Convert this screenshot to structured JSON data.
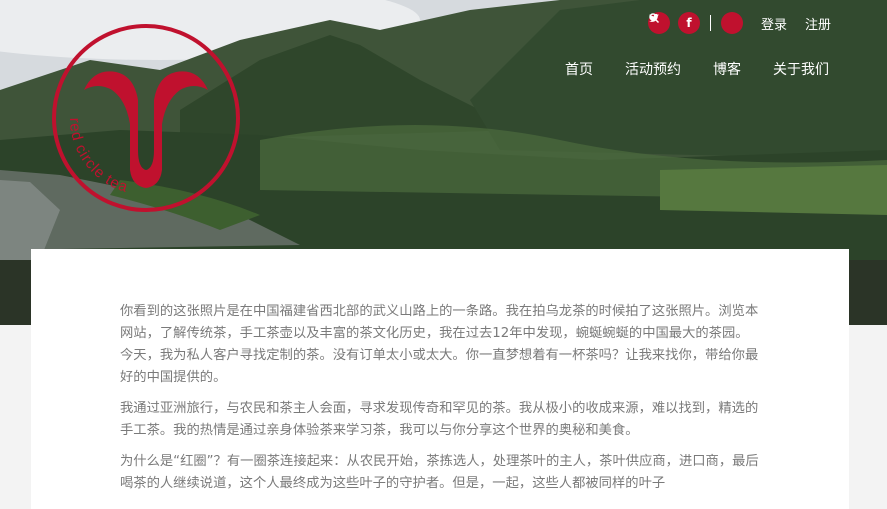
{
  "header": {
    "social": {
      "twitter_icon": "twitter-icon",
      "facebook_icon": "facebook-icon",
      "search_icon": "search-icon"
    },
    "login_label": "登录",
    "register_label": "注册",
    "nav": [
      "首页",
      "活动预约",
      "博客",
      "关于我们"
    ]
  },
  "logo": {
    "text": "red circle tea",
    "color": "#c0112e"
  },
  "body": {
    "paragraphs": [
      "你看到的这张照片是在中国福建省西北部的武义山路上的一条路。我在拍乌龙茶的时候拍了这张照片。浏览本网站，了解传统茶，手工茶壶以及丰富的茶文化历史，我在过去12年中发现，蜿蜒蜿蜒的中国最大的茶园。今天，我为私人客户寻找定制的茶。没有订单太小或太大。你一直梦想着有一杯茶吗？让我来找你，带给你最好的中国提供的。",
      "我通过亚洲旅行，与农民和茶主人会面，寻求发现传奇和罕见的茶。我从极小的收成来源，难以找到，精选的手工茶。我的热情是通过亲身体验茶来学习茶，我可以与你分享这个世界的奥秘和美食。",
      "为什么是“红圈”？有一圈茶连接起来：从农民开始，茶拣选人，处理茶叶的主人，茶叶供应商，进口商，最后喝茶的人继续说道，这个人最终成为这些叶子的守护者。但是，一起，这些人都被同样的叶子"
    ]
  }
}
